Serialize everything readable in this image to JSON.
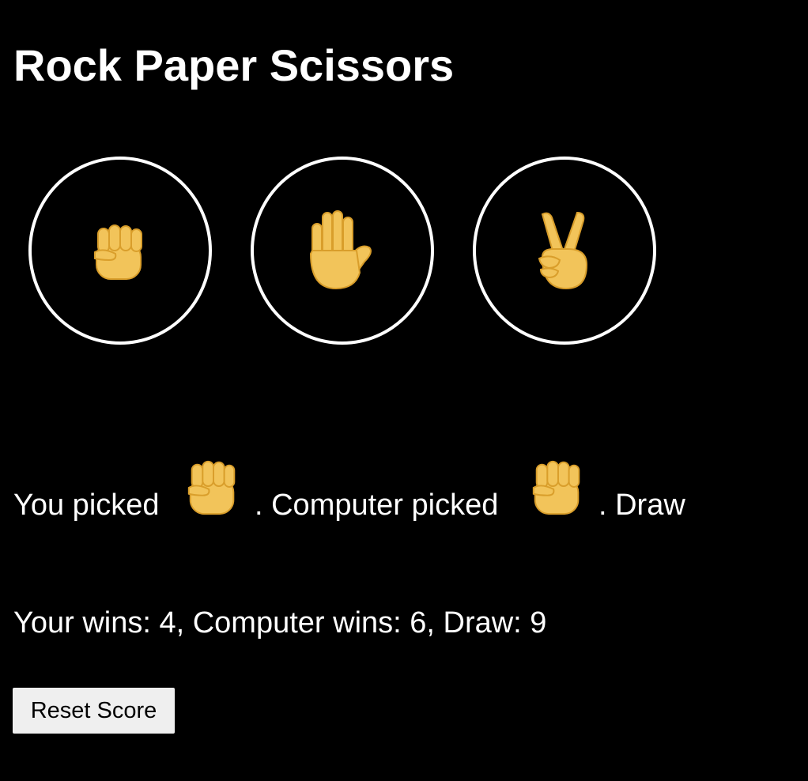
{
  "title": "Rock Paper Scissors",
  "choices": [
    {
      "label": "rock",
      "icon": "raised-fist-icon"
    },
    {
      "label": "paper",
      "icon": "raised-hand-icon"
    },
    {
      "label": "scissors",
      "icon": "victory-hand-icon"
    }
  ],
  "result": {
    "you_picked_text": "You picked",
    "player_choice_icon": "raised-fist-icon",
    "computer_picked_text": ". Computer picked",
    "computer_choice_icon": "raised-fist-icon",
    "outcome_text": ". Draw"
  },
  "score_text": "Your wins: 4, Computer wins: 6, Draw: 9",
  "reset_label": "Reset Score",
  "colors": {
    "background": "#000000",
    "text": "#ffffff",
    "emoji_skin": "#F2C45A",
    "emoji_outline": "#D99E2B",
    "button_bg": "#efefef"
  }
}
